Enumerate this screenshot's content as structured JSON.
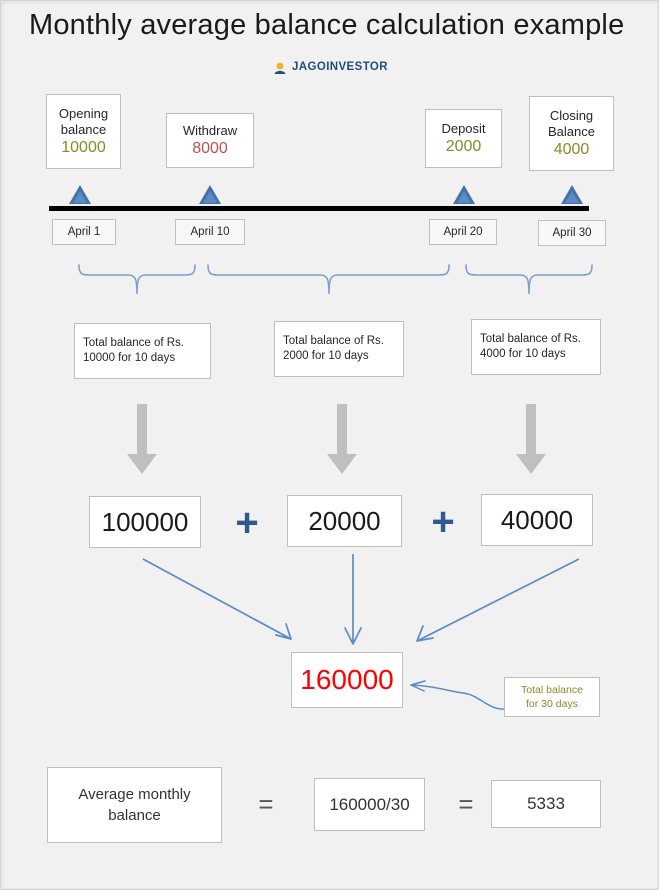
{
  "page": {
    "title": "Monthly average balance calculation example",
    "background_color": "#f1f1f1"
  },
  "brand": {
    "name": "JAGOINVESTOR",
    "color": "#1f4e79",
    "mark_icon": "jagoinvestor-logo-icon"
  },
  "timeline": {
    "marker_icon": "triangle-marker-icon",
    "events": [
      {
        "label": "Opening\nbalance",
        "label_line1": "Opening",
        "label_line2": "balance",
        "value": "10000",
        "value_color": "#8a8a2a",
        "date": "April 1"
      },
      {
        "label": "Withdraw",
        "label_line1": "Withdraw",
        "label_line2": "",
        "value": "8000",
        "value_color": "#c0504d",
        "date": "April 10"
      },
      {
        "label": "Deposit",
        "label_line1": "Deposit",
        "label_line2": "",
        "value": "2000",
        "value_color": "#8a8a2a",
        "date": "April 20"
      },
      {
        "label": "Closing\nBalance",
        "label_line1": "Closing",
        "label_line2": "Balance",
        "value": "4000",
        "value_color": "#8a8a2a",
        "date": "April 30"
      }
    ]
  },
  "periods": [
    {
      "note": "Total balance of Rs. 10000 for 10 days",
      "arrow_icon": "down-arrow-icon",
      "product": "100000"
    },
    {
      "note": "Total balance of Rs. 2000 for 10 days",
      "arrow_icon": "down-arrow-icon",
      "product": "20000"
    },
    {
      "note": "Total balance of Rs. 4000 for 10 days",
      "arrow_icon": "down-arrow-icon",
      "product": "40000"
    }
  ],
  "operators": {
    "plus": "+",
    "equals": "="
  },
  "sum": {
    "value": "160000",
    "value_color": "#ff0000",
    "annotation_line1": "Total balance",
    "annotation_line2": "for 30 days",
    "annotation_color": "#8a8a2a",
    "callout_arrow_icon": "curved-arrow-icon"
  },
  "result_row": {
    "label_line1": "Average monthly",
    "label_line2": "balance",
    "expression": "160000/30",
    "result": "5333"
  }
}
